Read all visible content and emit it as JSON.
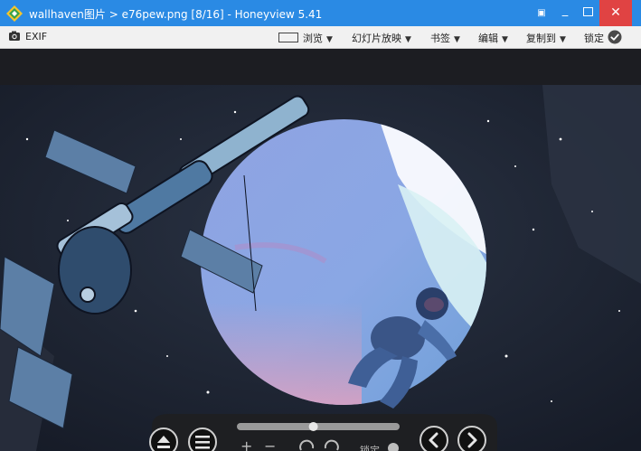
{
  "titlebar": {
    "title": "wallhaven图片 > e76pew.png [8/16] - Honeyview 5.41",
    "minimize_glyph": "_",
    "close_glyph": "✕",
    "pin_glyph": "▣"
  },
  "menubar": {
    "exif_label": "EXIF",
    "browse_label": "浏览",
    "slideshow_label": "幻灯片放映",
    "bookmark_label": "书签",
    "edit_label": "编辑",
    "copy_to_label": "复制到",
    "lock_label": "锁定",
    "caret": "▼"
  },
  "controlbar": {
    "seek_position": 0.47,
    "zoom_in_glyph": "+",
    "zoom_out_glyph": "−",
    "rotate_label": "锁定"
  },
  "icons": {
    "app": "honeyview-icon",
    "exif": "camera-icon",
    "browse": "browse-icon",
    "lock": "check-circle-icon",
    "eject": "eject-icon",
    "menu": "menu-icon",
    "prev": "chevron-left-icon",
    "next": "chevron-right-icon"
  },
  "colors": {
    "titlebar": "#2a8ae4",
    "close": "#e04343",
    "menubar": "#f1f1f1",
    "viewer_bg": "#1c1d22"
  }
}
